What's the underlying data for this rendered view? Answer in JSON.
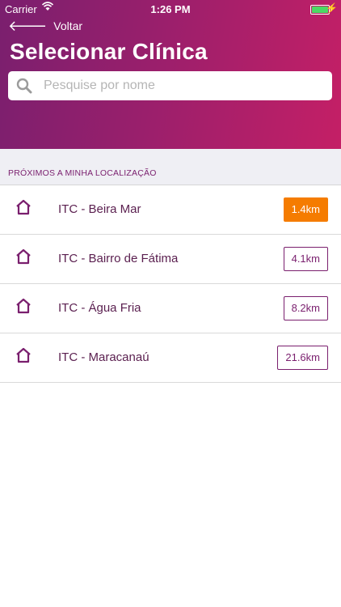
{
  "status_bar": {
    "carrier": "Carrier",
    "time": "1:26 PM"
  },
  "nav": {
    "back_label": "Voltar"
  },
  "page": {
    "title": "Selecionar Clínica"
  },
  "search": {
    "placeholder": "Pesquise por nome"
  },
  "section": {
    "label": "PRÓXIMOS A MINHA LOCALIZAÇÃO"
  },
  "clinics": [
    {
      "name": "ITC - Beira Mar",
      "distance": "1.4km",
      "highlighted": true
    },
    {
      "name": "ITC - Bairro de Fátima",
      "distance": "4.1km",
      "highlighted": false
    },
    {
      "name": "ITC - Água Fria",
      "distance": "8.2km",
      "highlighted": false
    },
    {
      "name": "ITC - Maracanaú",
      "distance": "21.6km",
      "highlighted": false
    }
  ],
  "colors": {
    "primary": "#7a1f6e",
    "accent": "#c41f66",
    "highlight": "#f57c00"
  },
  "icons": {
    "back": "arrow-left-icon",
    "search": "magnifier-icon",
    "clinic": "home-icon"
  }
}
